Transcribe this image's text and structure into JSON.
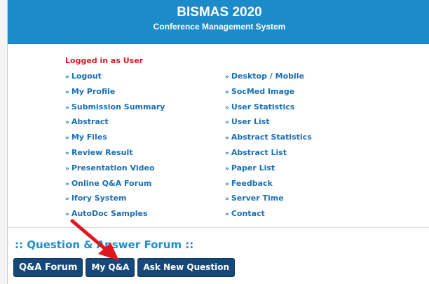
{
  "header": {
    "title": "BISMAS 2020",
    "subtitle": "Conference Management System"
  },
  "status": "Logged in as User",
  "menu": {
    "left": [
      "Logout",
      "My Profile",
      "Submission Summary",
      "Abstract",
      "My Files",
      "Review Result",
      "Presentation Video",
      "Online Q&A Forum",
      "Ifory System",
      "AutoDoc Samples"
    ],
    "right": [
      "Desktop / Mobile",
      "SocMed Image",
      "User Statistics",
      "User List",
      "Abstract Statistics",
      "Abstract List",
      "Paper List",
      "Feedback",
      "Server Time",
      "Contact"
    ],
    "bullet": "»"
  },
  "forum": {
    "title": ":: Question & Answer Forum ::",
    "buttons": {
      "qa_forum": "Q&A Forum",
      "my_qa": "My Q&A",
      "ask_new": "Ask New Question"
    }
  },
  "annotation": {
    "arrow_color": "#e0161e",
    "target": "my_qa"
  },
  "colors": {
    "header_bg": "#1d8bc9",
    "link": "#1a6fb5",
    "status": "#e0161e",
    "button_bg": "#16487a"
  }
}
